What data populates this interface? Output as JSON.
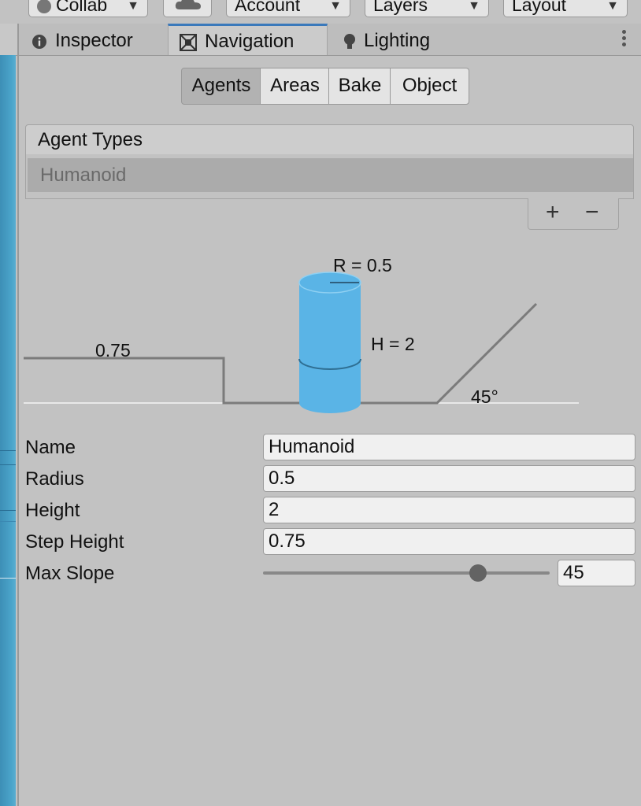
{
  "toolbar": {
    "collab_label": "Collab",
    "cloud_icon": "cloud-icon",
    "account_label": "Account",
    "layers_label": "Layers",
    "layout_label": "Layout"
  },
  "tabs": [
    {
      "label": "Inspector",
      "icon": "info-icon"
    },
    {
      "label": "Navigation",
      "icon": "navmesh-icon"
    },
    {
      "label": "Lighting",
      "icon": "bulb-icon"
    }
  ],
  "sub_tabs": [
    "Agents",
    "Areas",
    "Bake",
    "Object"
  ],
  "selected_sub_tab": "Agents",
  "agent_types": {
    "header": "Agent Types",
    "items": [
      "Humanoid"
    ],
    "add_label": "+",
    "remove_label": "−"
  },
  "diagram": {
    "radius_label": "R = 0.5",
    "height_label": "H = 2",
    "step_label": "0.75",
    "slope_label": "45°",
    "agent_color": "#5ab4e6"
  },
  "fields": [
    {
      "label": "Name",
      "value": "Humanoid"
    },
    {
      "label": "Radius",
      "value": "0.5"
    },
    {
      "label": "Height",
      "value": "2"
    },
    {
      "label": "Step Height",
      "value": "0.75"
    }
  ],
  "max_slope": {
    "label": "Max Slope",
    "value": "45",
    "slider_fraction": 0.75
  }
}
